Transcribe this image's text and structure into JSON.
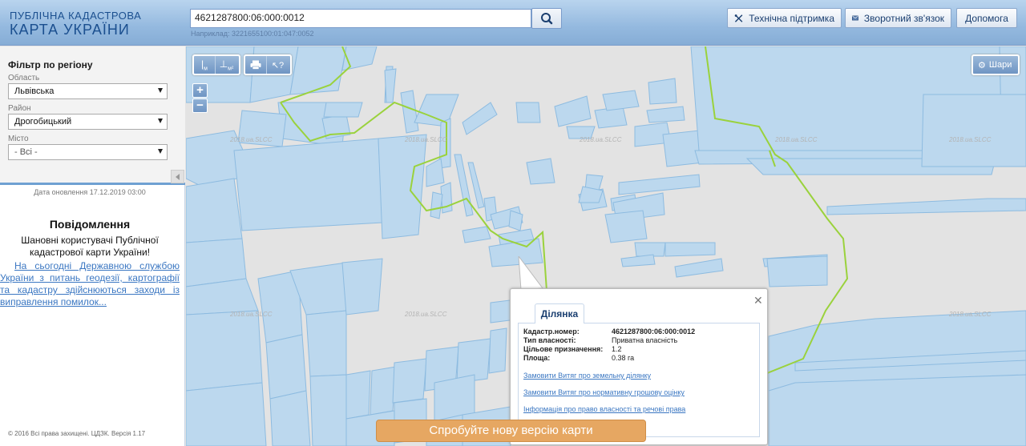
{
  "header": {
    "logo_line1": "ПУБЛІЧНА КАДАСТРОВА",
    "logo_line2": "КАРТА УКРАЇНИ",
    "search_value": "4621287800:06:000:0012",
    "search_hint": "Наприклад: 3221655100:01:047:0052",
    "buttons": {
      "support": "Технічна підтримка",
      "feedback": "Зворотний зв'язок",
      "help": "Допомога"
    }
  },
  "sidebar": {
    "filter_title": "Фільтр по регіону",
    "region_label": "Область",
    "region_value": "Львівська",
    "district_label": "Район",
    "district_value": "Дрогобицький",
    "city_label": "Місто",
    "city_value": "- Всі -",
    "update_date": "Дата оновлення  17.12.2019 03:00",
    "notice_title": "Повідомлення",
    "notice_text": "Шановні користувачі Публічної кадастрової карти України!",
    "notice_link": "На сьогодні Державною службою України з питань геодезії, картографії та кадастру здійснюються заходи із виправлення помилок...",
    "copyright": "© 2016 Всі права захищені. ЦДЗК. Версія 1.17"
  },
  "map": {
    "tools": {
      "measure_length_label": "м",
      "measure_area_label": "м²"
    },
    "zoom_in": "+",
    "zoom_out": "−",
    "layers_label": "Шари",
    "watermark_text": "2018.ua.SLCC",
    "parcel_fill": "#bcd8ee",
    "parcel_stroke": "#8dbbe0",
    "boundary_color": "#9ad23c"
  },
  "popup": {
    "tab_label": "Ділянка",
    "rows": [
      {
        "key": "Кадастр.номер:",
        "value": "4621287800:06:000:0012"
      },
      {
        "key": "Тип власності:",
        "value": "Приватна власність"
      },
      {
        "key": "Цільове призначення:",
        "value": "1.2"
      },
      {
        "key": "Площа:",
        "value": "0.38 га"
      }
    ],
    "links": [
      "Замовити Витяг про земельну ділянку",
      "Замовити Витяг про нормативну грошову оцінку",
      "Інформація про право власності та речові права"
    ]
  },
  "promo_label": "Спробуйте нову версію карти"
}
